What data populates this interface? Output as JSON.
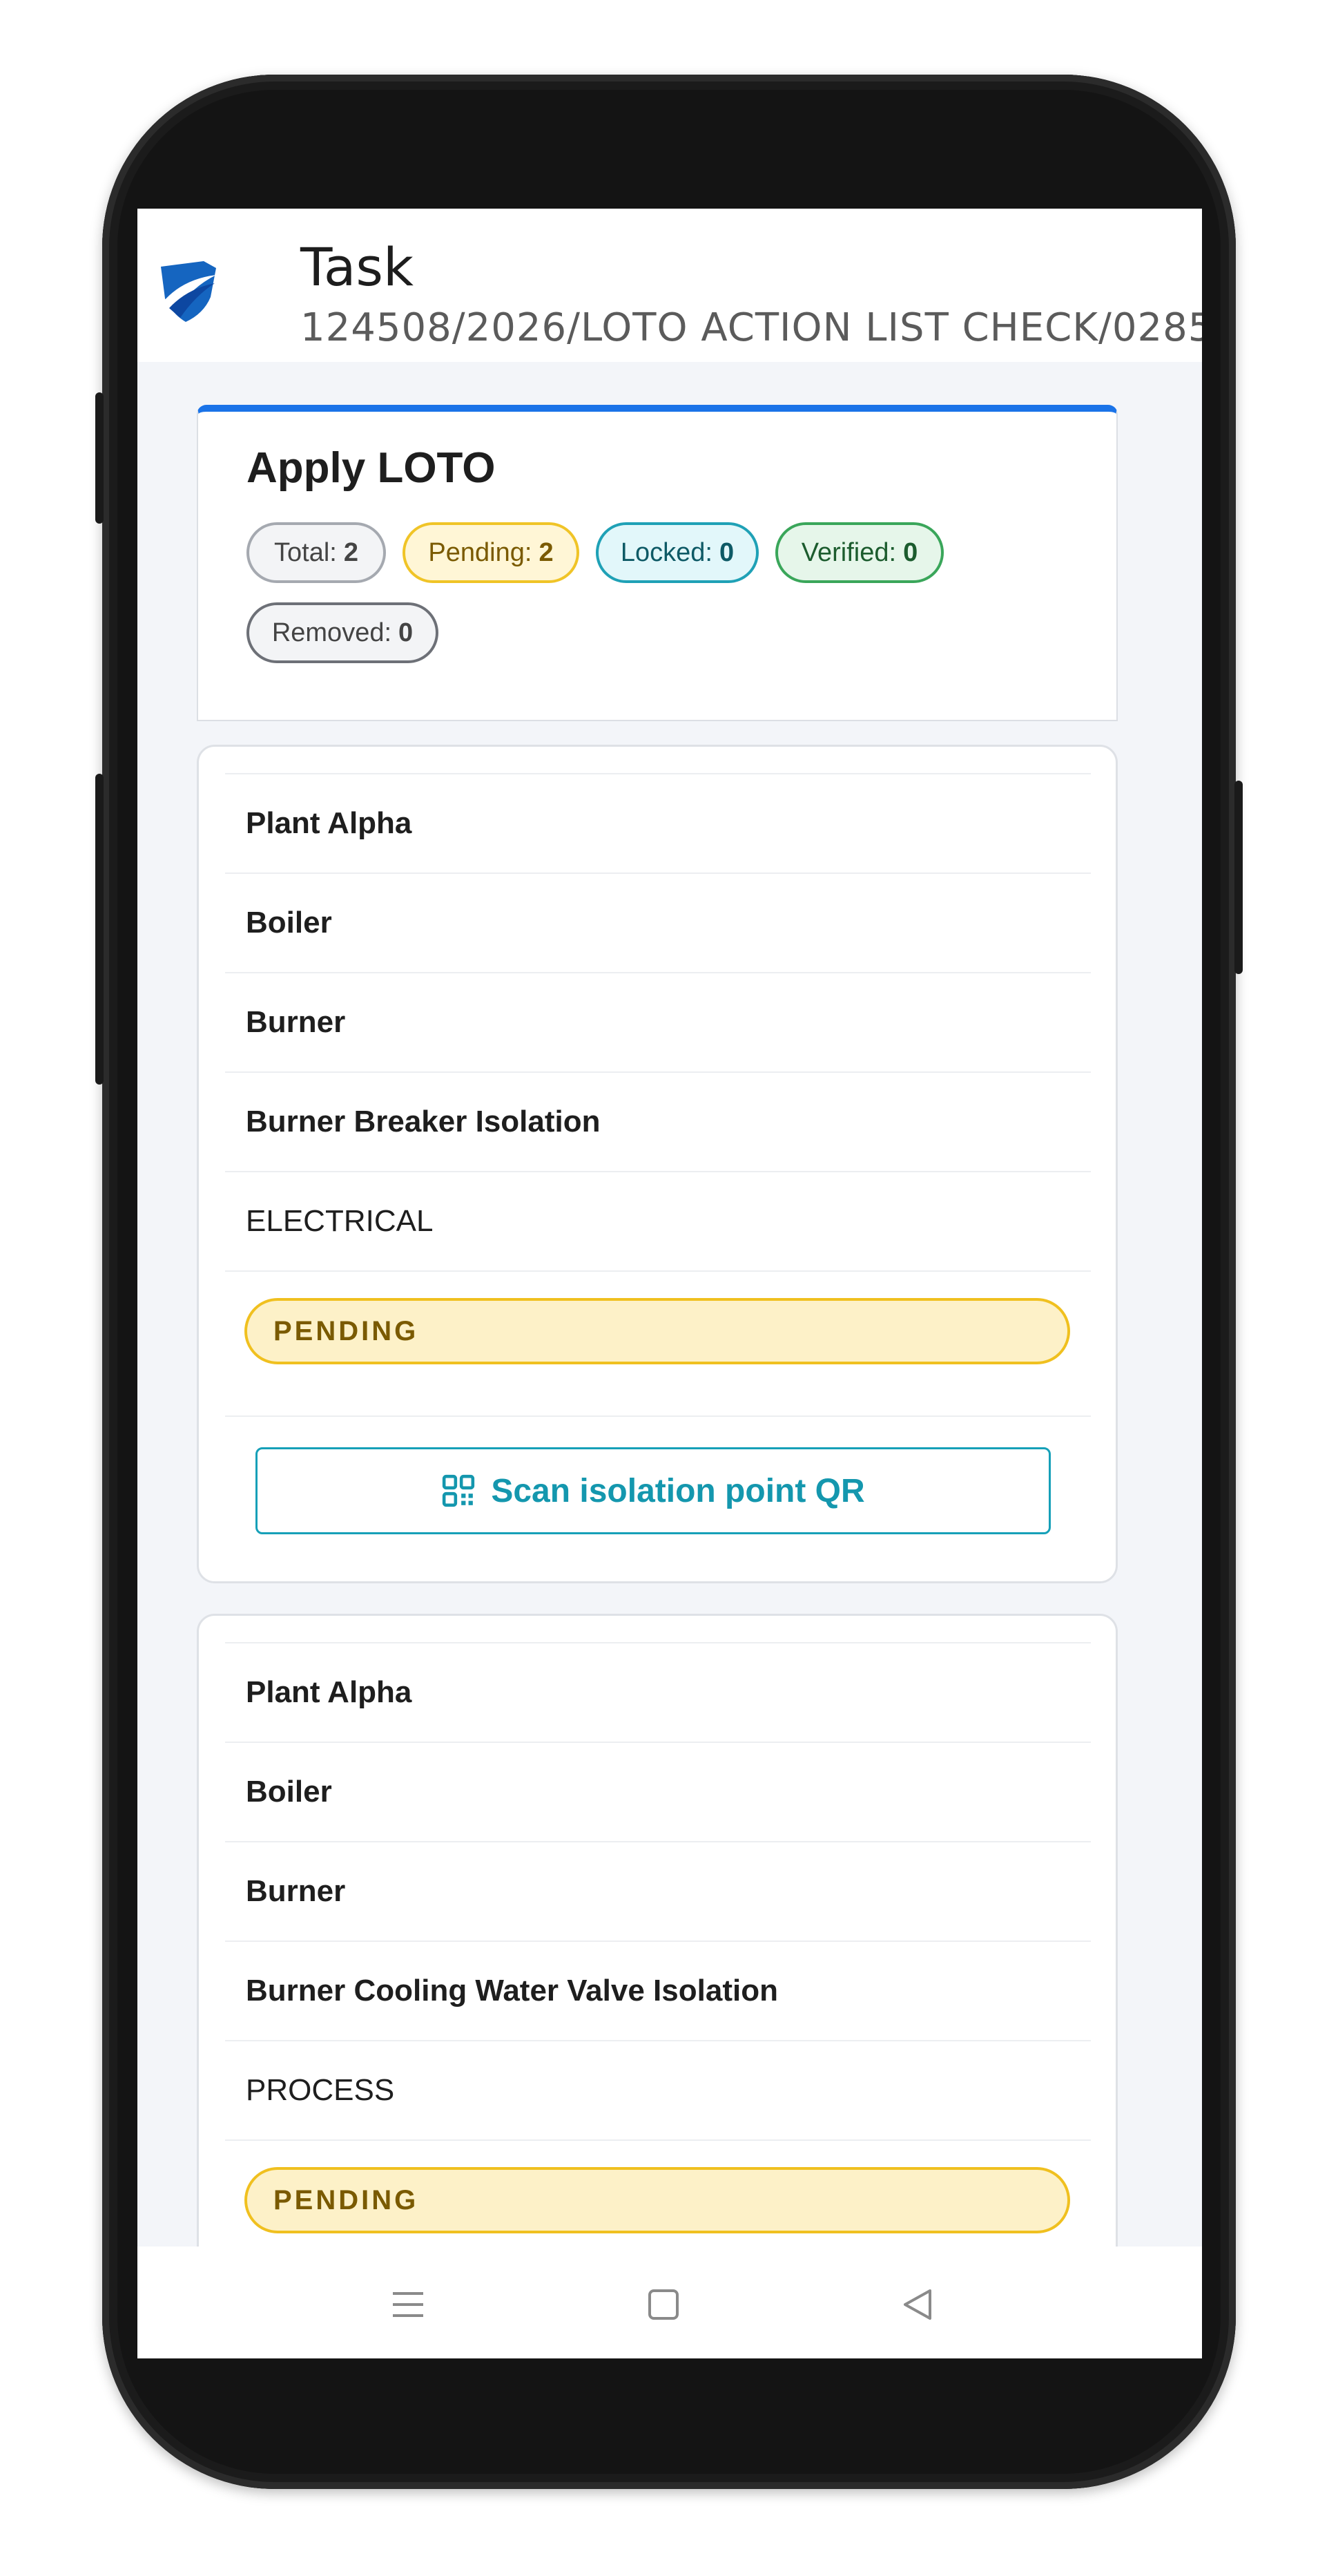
{
  "header": {
    "title": "Task",
    "subtitle": "124508/2026/LOTO ACTION LIST CHECK/0285"
  },
  "summary": {
    "title": "Apply LOTO",
    "counts": {
      "total_label": "Total:",
      "total": "2",
      "pending_label": "Pending:",
      "pending": "2",
      "locked_label": "Locked:",
      "locked": "0",
      "verified_label": "Verified:",
      "verified": "0",
      "removed_label": "Removed:",
      "removed": "0"
    }
  },
  "items": [
    {
      "plant": "Plant Alpha",
      "area": "Boiler",
      "equipment": "Burner",
      "isolation": "Burner Breaker Isolation",
      "type": "ELECTRICAL",
      "status": "PENDING",
      "action_label": "Scan isolation point QR"
    },
    {
      "plant": "Plant Alpha",
      "area": "Boiler",
      "equipment": "Burner",
      "isolation": "Burner Cooling Water Valve Isolation",
      "type": "PROCESS",
      "status": "PENDING"
    }
  ],
  "colors": {
    "accent": "#1a73e8",
    "pending": "#f0c01f",
    "locked": "#1fa1b6",
    "verified": "#3aa65a",
    "action": "#1497ae"
  },
  "icons": {
    "logo": "shield-logo",
    "scan": "qr-code-icon",
    "nav": [
      "menu-icon",
      "home-square-icon",
      "back-triangle-icon"
    ]
  }
}
